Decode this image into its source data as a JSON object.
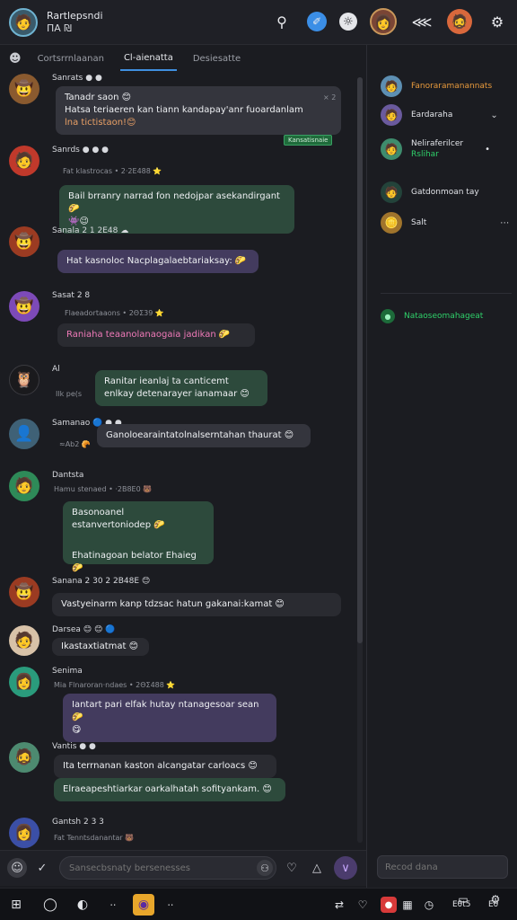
{
  "header": {
    "user_name": "Rartlepsndi",
    "user_sub": "ПА ₪"
  },
  "tabs": [
    {
      "label": "Cortsrrnlaanan"
    },
    {
      "label": "Cl-aienatta"
    },
    {
      "label": "Desiesatte"
    }
  ],
  "messages": [
    {
      "name": "Sanrats ● ●",
      "meta": "",
      "lines": [
        "Tanadr saon 😊",
        "Hatsa teriaeren kan tiann kandapay'anr fuoardanlam",
        "lna tictistaon!😊"
      ],
      "time": "× 2",
      "tag": "Kansatisnaie"
    },
    {
      "name": "Sanrds ● ● ●",
      "meta": "Fat klastrocas • 2·2E488 ⭐",
      "lines": [
        "Bail brranry narrad fon nedojpar asekandirgant 🌮",
        "👾😉"
      ]
    },
    {
      "name": "Sanala 2 1 2E48 ☁",
      "meta": "",
      "lines": [
        "Hat kasnoloc Nacplagalaebtariaksay: 🌮"
      ]
    },
    {
      "name": "Sasat 2 8",
      "meta": "Flaeadortaaons • 2ΘΣ39 ⭐",
      "lines": [
        "Raniaha teaanolanaogaia jadikan 🌮"
      ]
    },
    {
      "name": "Al",
      "meta": "Ilk pe(s",
      "lines": [
        "Ranitar ieanlaj ta canticemt",
        "enlkay detenarayer ianamaar 😊"
      ]
    },
    {
      "name": "Samanao 🔵 ● ●",
      "meta": "≈Ab2 🥐",
      "lines": [
        "Ganoloearaintatolnalserntahan thaurat 😊"
      ]
    },
    {
      "name": "Dantsta",
      "meta": "Hamu stenaed • ·2B8Ε0 🐻",
      "lines": [
        "Basonoanel estanvertoniodep 🌮",
        "",
        "Ehatinagoan belator Ehaieg 🌮"
      ]
    },
    {
      "name": "Sanana 2 30 2 2B48E 😊",
      "meta": "",
      "lines": [
        "Vastyeinarm kanp tdzsac hatun gakanai:kamat 😊"
      ]
    },
    {
      "name": "Darsea 😊 😊 🔵",
      "meta": "",
      "lines": [
        "Ikastaxtiatmat 😊"
      ]
    },
    {
      "name": "Senima",
      "meta": "Mia Flnaroran·ndaes • 2ΘΣ488 ⭐",
      "lines": [
        "Iantart pari elfak hutay ntanagesoar sean 🌮",
        "😋"
      ]
    },
    {
      "name": "Vantis ● ●",
      "meta": "",
      "lines": [
        "Ita terrnanan kaston alcangatar carloacs 😊",
        "Elraeapeshtiarkar oarkalhatah sofityankam. 😊"
      ]
    },
    {
      "name": "Gantsh 2 3 3",
      "meta": "Fat Tenntsdanantar 🐻",
      "lines": []
    }
  ],
  "sidebar": {
    "items": [
      {
        "label": "Fanoraramanannats",
        "sub": ""
      },
      {
        "label": "Eardaraha",
        "sub": ""
      },
      {
        "label": "Neliraferilcer",
        "sub": "Rslihar"
      },
      {
        "label": "Gatdonmoan tay",
        "sub": ""
      },
      {
        "label": "Salt",
        "sub": ""
      },
      {
        "label": "Nataoseomahageat",
        "sub": ""
      }
    ],
    "search_placeholder": "Recod dana"
  },
  "composer": {
    "placeholder": "Sansecbsnaty bersenesses"
  },
  "taskbar": {
    "label_a": "Eθ",
    "label_b": "Eθt5"
  },
  "colors": {
    "accent": "#3f8fe0",
    "online": "#2fd06a",
    "bubble_green": "#2d4a3c",
    "bubble_purple": "#433b5e"
  }
}
